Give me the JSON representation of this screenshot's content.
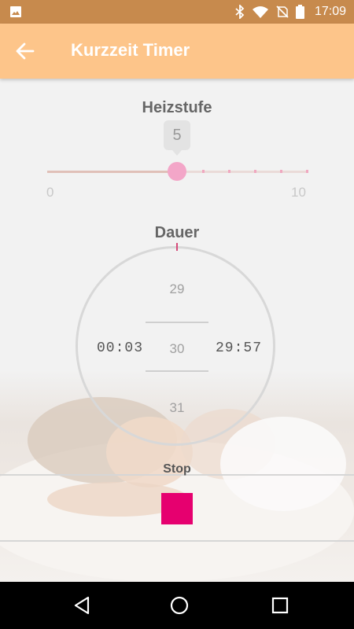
{
  "statusbar": {
    "time": "17:09",
    "icons": [
      "image-icon",
      "bluetooth-icon",
      "wifi-icon",
      "no-sim-icon",
      "battery-icon"
    ]
  },
  "appbar": {
    "title": "Kurzzeit Timer",
    "back_icon": "arrow-left-icon"
  },
  "heat": {
    "title": "Heizstufe",
    "value": 5,
    "value_label": "5",
    "min": 0,
    "max": 10,
    "min_label": "0",
    "max_label": "10"
  },
  "duration": {
    "title": "Dauer",
    "prev": "29",
    "current": "30",
    "next": "31",
    "elapsed": "00:03",
    "remaining": "29:57"
  },
  "stop": {
    "label": "Stop"
  },
  "colors": {
    "appbar": "#fdc58a",
    "statusbar": "#c78a4d",
    "accent": "#e6006f",
    "thumb": "#f3a6c8"
  },
  "navbar": {
    "icons": [
      "back-triangle-icon",
      "home-circle-icon",
      "recents-square-icon"
    ]
  }
}
